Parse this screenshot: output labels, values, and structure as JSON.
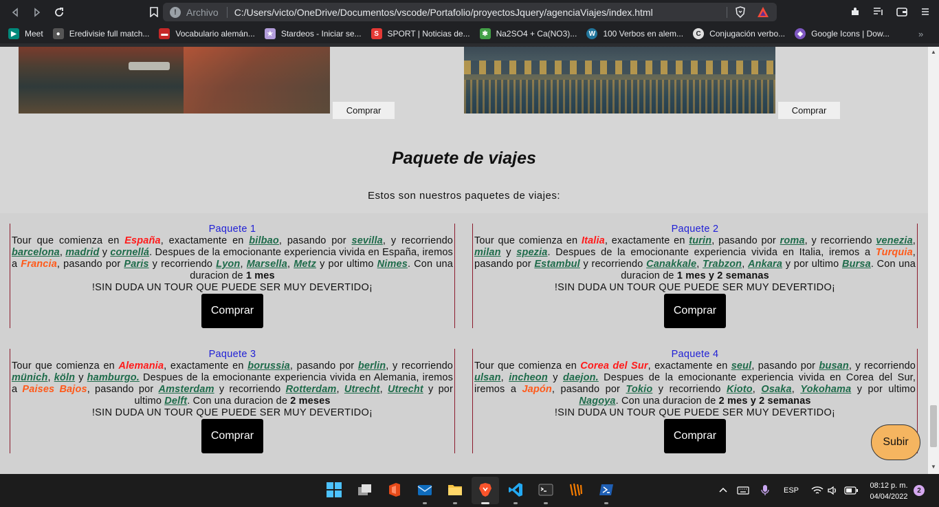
{
  "browser": {
    "address": {
      "scheme": "Archivo",
      "url": "C:/Users/victo/OneDrive/Documentos/vscode/Portafolio/proyectosJquery/agenciaViajes/index.html"
    },
    "bookmarks": [
      {
        "label": "Meet",
        "icon": "meet-icon",
        "color": "#00897b"
      },
      {
        "label": "Eredivisie full match...",
        "icon": "soccer-icon",
        "color": "#555555"
      },
      {
        "label": "Vocabulario alemán...",
        "icon": "vocab-icon",
        "color": "#c62828"
      },
      {
        "label": "Stardeos - Iniciar se...",
        "icon": "stardeos-icon",
        "color": "#b39ddb"
      },
      {
        "label": "SPORT | Noticias de...",
        "icon": "sport-icon",
        "color": "#e53935"
      },
      {
        "label": "Na2SO4 + Ca(NO3)...",
        "icon": "chem-icon",
        "color": "#43a047"
      },
      {
        "label": "100 Verbos en alem...",
        "icon": "wordpress-icon",
        "color": "#21759b"
      },
      {
        "label": "Conjugación verbo...",
        "icon": "conjugation-icon",
        "color": "#e0e0e0"
      },
      {
        "label": "Google Icons | Dow...",
        "icon": "google-icons-icon",
        "color": "#7e57c2"
      }
    ]
  },
  "gallery": {
    "buy_label_1": "Comprar",
    "buy_label_2": "Comprar"
  },
  "packages_section": {
    "title": "Paquete de viajes",
    "subtitle": "Estos son nuestros paquetes de viajes:",
    "closing": "!SIN DUDA UN TOUR QUE PUEDE SER MUY DEVERTIDO¡",
    "buy_label": "Comprar",
    "packages": [
      {
        "title": "Paquete  1",
        "w": [
          "Tour que comienza en",
          ", exactamente en",
          ", pasando por",
          ", y recorriendo",
          ",",
          "y",
          ". Despues de la emocionante experiencia vivida en España, iremos a",
          ", pasando por",
          "y recorriendo",
          ",",
          ",",
          "y por ultimo",
          ". Con una duracion de"
        ],
        "country": "España",
        "c1": "bilbao",
        "c2": "sevilla",
        "c3": "barcelona",
        "c4": "madrid",
        "c5": "cornellá",
        "next_country": "Francia",
        "c6": "Paris",
        "c7": "Lyon",
        "c8": "Marsella",
        "c9": "Metz",
        "c10": "Nimes",
        "duration": "1 mes"
      },
      {
        "title": "Paquete  2",
        "w": [
          "Tour que comienza en",
          ", exactamente en",
          ", pasando por",
          ", y recorriendo",
          ",",
          "y",
          ". Despues de la emocionante experiencia vivida en Italia, iremos a",
          ", pasando por",
          "y recorriendo",
          ",",
          ",",
          "y por ultimo",
          ". Con una duracion de"
        ],
        "country": "Italia",
        "c1": "turin",
        "c2": "roma",
        "c3": "venezia",
        "c4": "milan",
        "c5": "spezia",
        "next_country": "Turquia",
        "c6": "Estambul",
        "c7": "Canakkale",
        "c8": "Trabzon",
        "c9": "Ankara",
        "c10": "Bursa",
        "duration": "1 mes y 2 semanas"
      },
      {
        "title": "Paquete 3",
        "w": [
          "Tour que comienza en",
          ", exactamente en",
          ", pasando por",
          ", y recorriendo",
          ",",
          "y",
          " Despues de la emocionante experiencia vivida en Alemania, iremos a",
          ", pasando por",
          "y recorriendo",
          ",",
          ",",
          "y por ultimo",
          ". Con una duracion de"
        ],
        "country": "Alemania",
        "c1": "borussia",
        "c2": "berlin",
        "c3": "münich",
        "c4": "köln",
        "c5": "hamburgo.",
        "next_country": "Paises Bajos",
        "c6": "Amsterdam",
        "c7": "Rotterdam",
        "c8": "Utrecht",
        "c9": "Utrecht",
        "c10": "Delft",
        "duration": "2 meses"
      },
      {
        "title": "Paquete 4",
        "w": [
          "Tour que comienza en",
          ", exactamente en",
          ", pasando por",
          ", y recorriendo",
          ",",
          "y",
          " Despues de la emocionante experiencia vivida en Corea del Sur, iremos a",
          ", pasando por",
          "y recorriendo",
          ",",
          ",",
          "y por ultimo",
          ". Con una duracion de"
        ],
        "country": "Corea del Sur",
        "c1": "seul",
        "c2": "busan",
        "c3": "ulsan",
        "c4": "incheon",
        "c5": "daejon.",
        "next_country": "Japón",
        "c6": "Tokio",
        "c7": "Kioto",
        "c8": "Osaka",
        "c9": "Yokohama",
        "c10": "Nagoya",
        "duration": "2 mes y 2 semanas"
      }
    ]
  },
  "scroll_top_label": "Subir",
  "taskbar": {
    "language": "ESP",
    "time": "08:12 p. m.",
    "date": "04/04/2022",
    "notifications": "2"
  }
}
